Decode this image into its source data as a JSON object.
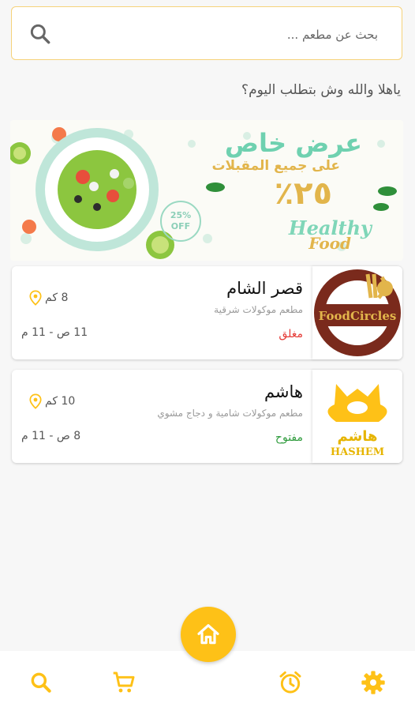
{
  "search": {
    "placeholder": "بحث عن مطعم ..."
  },
  "greeting": "ياهلا والله وش بتطلب اليوم؟",
  "banner": {
    "title": "عرض خاص",
    "subtitle": "على جميع المقبلات",
    "discount": "٢٥٪",
    "brand_line1": "Healthy",
    "brand_line2": "Food",
    "badge_line1": "25%",
    "badge_line2": "OFF"
  },
  "restaurants": [
    {
      "name": "قصر الشام",
      "description": "مطعم موكولات شرقية",
      "distance": "8 كم",
      "hours": "11 ص - 11 م",
      "status": "مغلق",
      "logo_text": "FoodCircles"
    },
    {
      "name": "هاشم",
      "description": "مطعم موكولات شامية و دجاج مشوي",
      "distance": "10 كم",
      "hours": "8 ص - 11 م",
      "status": "مفتوح",
      "logo_text_ar": "هاشم",
      "logo_text_en": "HASHEM"
    }
  ],
  "colors": {
    "accent": "#fec117",
    "closed": "#e53935",
    "open": "#2e9b3c"
  },
  "nav": {
    "items": [
      "search-icon",
      "cart-icon",
      "home-icon",
      "alarm-icon",
      "settings-icon"
    ]
  }
}
